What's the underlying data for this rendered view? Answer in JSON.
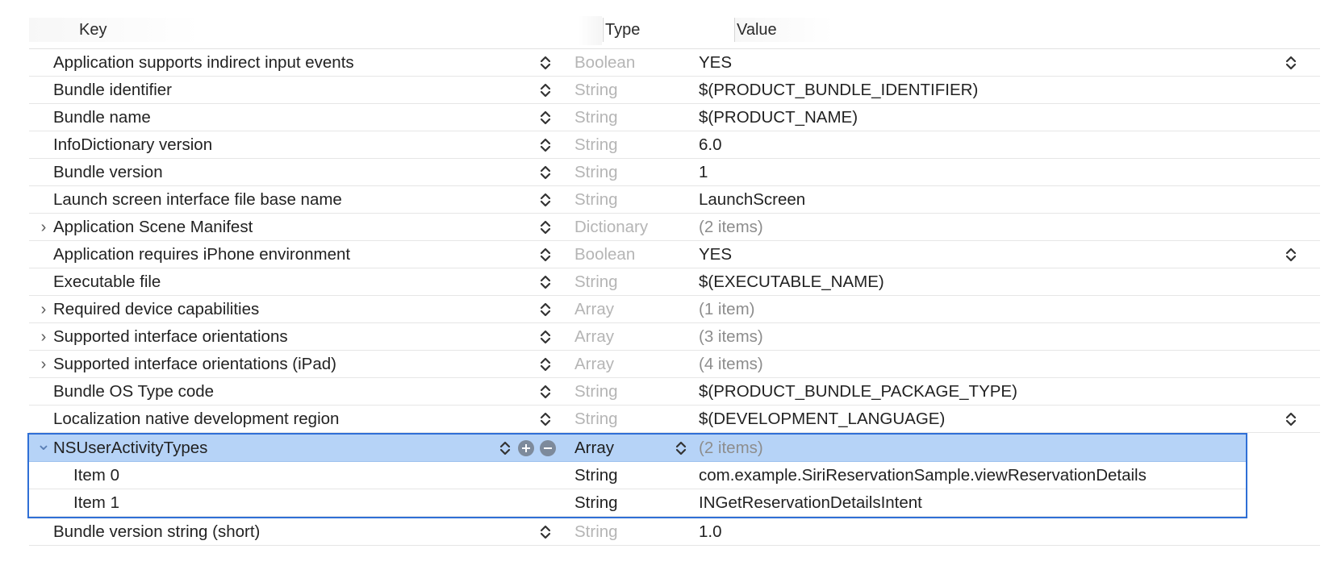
{
  "header": {
    "key": "Key",
    "type": "Type",
    "value": "Value"
  },
  "rows": [
    {
      "key": "Application supports indirect input events",
      "type": "Boolean",
      "value": "YES",
      "value_stepper": true
    },
    {
      "key": "Bundle identifier",
      "type": "String",
      "value": "$(PRODUCT_BUNDLE_IDENTIFIER)"
    },
    {
      "key": "Bundle name",
      "type": "String",
      "value": "$(PRODUCT_NAME)"
    },
    {
      "key": "InfoDictionary version",
      "type": "String",
      "value": "6.0"
    },
    {
      "key": "Bundle version",
      "type": "String",
      "value": "1"
    },
    {
      "key": "Launch screen interface file base name",
      "type": "String",
      "value": "LaunchScreen"
    },
    {
      "key": "Application Scene Manifest",
      "type": "Dictionary",
      "value": "(2 items)",
      "expandable": true
    },
    {
      "key": "Application requires iPhone environment",
      "type": "Boolean",
      "value": "YES",
      "value_stepper": true
    },
    {
      "key": "Executable file",
      "type": "String",
      "value": "$(EXECUTABLE_NAME)"
    },
    {
      "key": "Required device capabilities",
      "type": "Array",
      "value": "(1 item)",
      "expandable": true
    },
    {
      "key": "Supported interface orientations",
      "type": "Array",
      "value": "(3 items)",
      "expandable": true
    },
    {
      "key": "Supported interface orientations (iPad)",
      "type": "Array",
      "value": "(4 items)",
      "expandable": true
    },
    {
      "key": "Bundle OS Type code",
      "type": "String",
      "value": "$(PRODUCT_BUNDLE_PACKAGE_TYPE)"
    },
    {
      "key": "Localization native development region",
      "type": "String",
      "value": "$(DEVELOPMENT_LANGUAGE)",
      "value_stepper": true
    }
  ],
  "selected": {
    "key": "NSUserActivityTypes",
    "type": "Array",
    "value": "(2 items)",
    "children": [
      {
        "key": "Item 0",
        "type": "String",
        "value": "com.example.SiriReservationSample.viewReservationDetails"
      },
      {
        "key": "Item 1",
        "type": "String",
        "value": "INGetReservationDetailsIntent"
      }
    ]
  },
  "last_row": {
    "key": "Bundle version string (short)",
    "type": "String",
    "value": "1.0"
  },
  "icons": {
    "disclosure_collapsed": "chevron-right-icon",
    "disclosure_expanded": "chevron-down-icon",
    "stepper": "up-down-chevron-icon",
    "add": "plus-circle-icon",
    "remove": "minus-circle-icon"
  },
  "colors": {
    "selection_fill": "#b6d3f7",
    "selection_border": "#2f6fd6",
    "dim_type": "#b5b5b5",
    "dim_value": "#8d8d8d"
  }
}
